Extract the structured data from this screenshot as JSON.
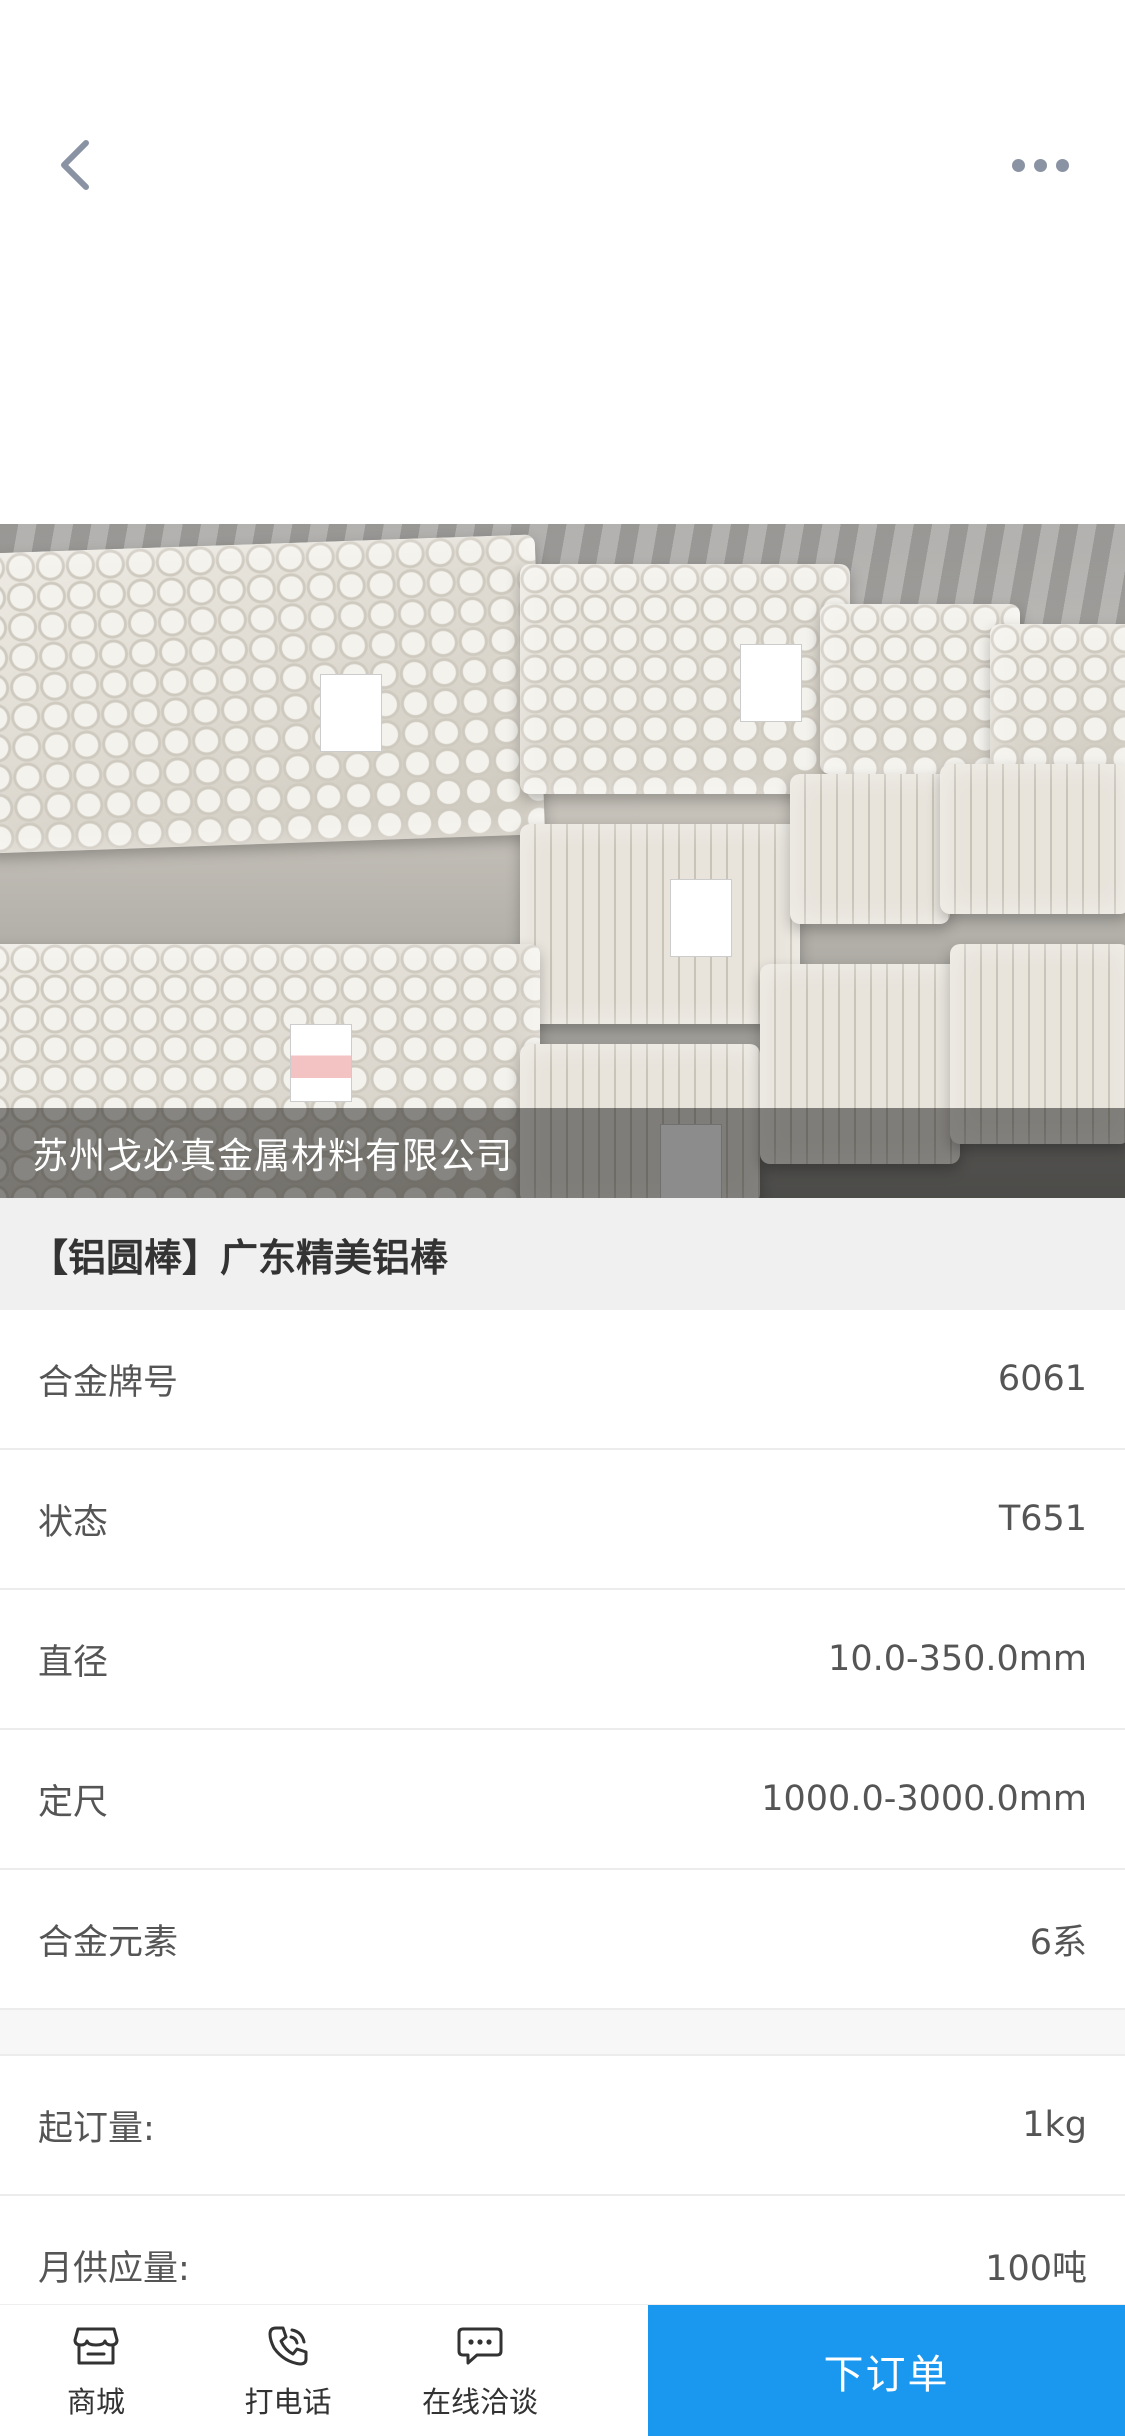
{
  "nav": {
    "back_icon": "chevron-left-icon",
    "more_icon": "more-horizontal-icon"
  },
  "hero": {
    "company_name": "苏州戈必真金属材料有限公司"
  },
  "product": {
    "title": "【铝圆棒】广东精美铝棒"
  },
  "specs": [
    {
      "label": "合金牌号",
      "value": "6061"
    },
    {
      "label": "状态",
      "value": "T651"
    },
    {
      "label": "直径",
      "value": "10.0-350.0mm"
    },
    {
      "label": "定尺",
      "value": "1000.0-3000.0mm"
    },
    {
      "label": "合金元素",
      "value": "6系"
    }
  ],
  "supply": [
    {
      "label": "起订量:",
      "value": "1kg"
    },
    {
      "label": "月供应量:",
      "value": "100吨"
    }
  ],
  "bottom_bar": {
    "shop": {
      "label": "商城",
      "icon": "store-icon"
    },
    "call": {
      "label": "打电话",
      "icon": "phone-icon"
    },
    "chat": {
      "label": "在线洽谈",
      "icon": "chat-icon"
    },
    "order_label": "下订单"
  },
  "colors": {
    "accent": "#1a98f0",
    "title_bg": "#f0f0f0",
    "text": "#333333"
  }
}
